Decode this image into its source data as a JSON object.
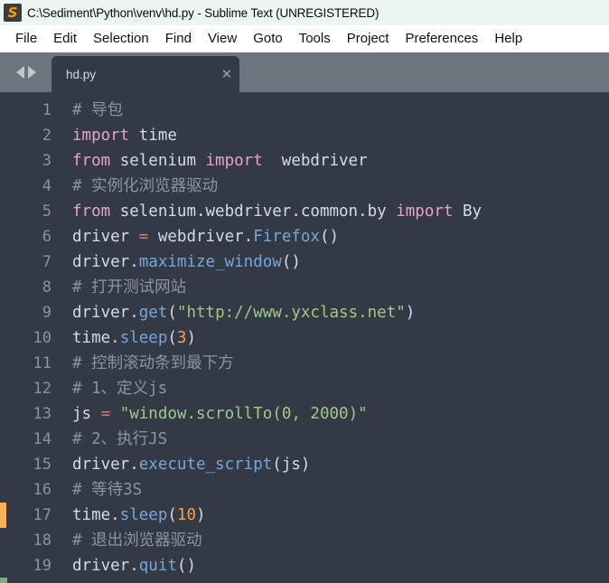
{
  "window": {
    "title": "C:\\Sediment\\Python\\venv\\hd.py - Sublime Text (UNREGISTERED)",
    "logo_glyph": "S"
  },
  "menubar": {
    "items": [
      {
        "label": "File"
      },
      {
        "label": "Edit"
      },
      {
        "label": "Selection"
      },
      {
        "label": "Find"
      },
      {
        "label": "View"
      },
      {
        "label": "Goto"
      },
      {
        "label": "Tools"
      },
      {
        "label": "Project"
      },
      {
        "label": "Preferences"
      },
      {
        "label": "Help"
      }
    ]
  },
  "tabbar": {
    "nav_prev": "◀",
    "nav_next": "▶",
    "tabs": [
      {
        "label": "hd.py",
        "close_glyph": "✕",
        "active": true
      }
    ]
  },
  "editor": {
    "language": "Python",
    "colors": {
      "background": "#333a45",
      "line_number": "#8a939f",
      "comment": "#8d949e",
      "keyword": "#e8a2c8",
      "function": "#78a6d8",
      "string": "#9fc98a",
      "number": "#f2a04a",
      "operator": "#e8795a",
      "text": "#d6dbe3",
      "gutter_marker": "#f9b05a",
      "bottom_marker": "#7fae7a"
    },
    "lines": [
      {
        "n": "1",
        "marker": "",
        "tokens": [
          {
            "t": "comment",
            "s": "# 导包"
          }
        ]
      },
      {
        "n": "2",
        "marker": "",
        "tokens": [
          {
            "t": "keyword",
            "s": "import"
          },
          {
            "t": "plain",
            "s": " time"
          }
        ]
      },
      {
        "n": "3",
        "marker": "",
        "tokens": [
          {
            "t": "keyword",
            "s": "from"
          },
          {
            "t": "plain",
            "s": " selenium "
          },
          {
            "t": "keyword",
            "s": "import"
          },
          {
            "t": "plain",
            "s": "  webdriver"
          }
        ]
      },
      {
        "n": "4",
        "marker": "",
        "tokens": [
          {
            "t": "comment",
            "s": "# 实例化浏览器驱动"
          }
        ]
      },
      {
        "n": "5",
        "marker": "",
        "tokens": [
          {
            "t": "keyword",
            "s": "from"
          },
          {
            "t": "plain",
            "s": " selenium.webdriver.common.by "
          },
          {
            "t": "keyword",
            "s": "import"
          },
          {
            "t": "plain",
            "s": " By"
          }
        ]
      },
      {
        "n": "6",
        "marker": "",
        "tokens": [
          {
            "t": "plain",
            "s": "driver "
          },
          {
            "t": "op",
            "s": "="
          },
          {
            "t": "plain",
            "s": " webdriver."
          },
          {
            "t": "func",
            "s": "Firefox"
          },
          {
            "t": "punct",
            "s": "()"
          }
        ]
      },
      {
        "n": "7",
        "marker": "",
        "tokens": [
          {
            "t": "plain",
            "s": "driver."
          },
          {
            "t": "func",
            "s": "maximize_window"
          },
          {
            "t": "punct",
            "s": "()"
          }
        ]
      },
      {
        "n": "8",
        "marker": "",
        "tokens": [
          {
            "t": "comment",
            "s": "# 打开测试网站"
          }
        ]
      },
      {
        "n": "9",
        "marker": "",
        "tokens": [
          {
            "t": "plain",
            "s": "driver."
          },
          {
            "t": "func",
            "s": "get"
          },
          {
            "t": "punct",
            "s": "("
          },
          {
            "t": "string",
            "s": "\"http://www.yxclass.net\""
          },
          {
            "t": "punct",
            "s": ")"
          }
        ]
      },
      {
        "n": "10",
        "marker": "",
        "tokens": [
          {
            "t": "plain",
            "s": "time."
          },
          {
            "t": "func",
            "s": "sleep"
          },
          {
            "t": "punct",
            "s": "("
          },
          {
            "t": "number",
            "s": "3"
          },
          {
            "t": "punct",
            "s": ")"
          }
        ]
      },
      {
        "n": "11",
        "marker": "",
        "tokens": [
          {
            "t": "comment",
            "s": "# 控制滚动条到最下方"
          }
        ]
      },
      {
        "n": "12",
        "marker": "",
        "tokens": [
          {
            "t": "comment",
            "s": "# 1、定义js"
          }
        ]
      },
      {
        "n": "13",
        "marker": "",
        "tokens": [
          {
            "t": "plain",
            "s": "js "
          },
          {
            "t": "op",
            "s": "="
          },
          {
            "t": "plain",
            "s": " "
          },
          {
            "t": "string",
            "s": "\"window.scrollTo(0, 2000)\""
          }
        ]
      },
      {
        "n": "14",
        "marker": "",
        "tokens": [
          {
            "t": "comment",
            "s": "# 2、执行JS"
          }
        ]
      },
      {
        "n": "15",
        "marker": "",
        "tokens": [
          {
            "t": "plain",
            "s": "driver."
          },
          {
            "t": "func",
            "s": "execute_script"
          },
          {
            "t": "punct",
            "s": "("
          },
          {
            "t": "plain",
            "s": "js"
          },
          {
            "t": "punct",
            "s": ")"
          }
        ]
      },
      {
        "n": "16",
        "marker": "",
        "tokens": [
          {
            "t": "comment",
            "s": "# 等待3S"
          }
        ]
      },
      {
        "n": "17",
        "marker": "orange",
        "tokens": [
          {
            "t": "plain",
            "s": "time."
          },
          {
            "t": "func",
            "s": "sleep"
          },
          {
            "t": "punct",
            "s": "("
          },
          {
            "t": "number",
            "s": "10"
          },
          {
            "t": "punct",
            "s": ")"
          }
        ]
      },
      {
        "n": "18",
        "marker": "",
        "tokens": [
          {
            "t": "comment",
            "s": "# 退出浏览器驱动"
          }
        ]
      },
      {
        "n": "19",
        "marker": "",
        "tokens": [
          {
            "t": "plain",
            "s": "driver."
          },
          {
            "t": "func",
            "s": "quit"
          },
          {
            "t": "punct",
            "s": "()"
          }
        ]
      }
    ]
  }
}
